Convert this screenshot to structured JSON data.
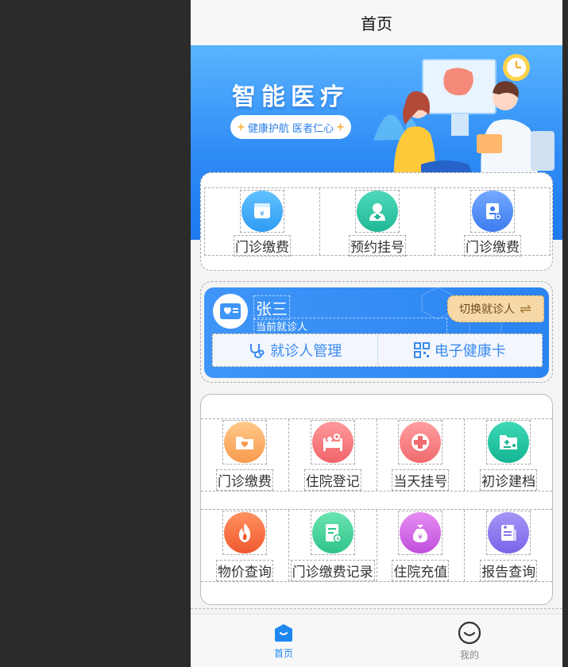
{
  "header": {
    "title": "首页"
  },
  "banner": {
    "title": "智能医疗",
    "slogan": "健康护航 医者仁心"
  },
  "quick_actions": [
    {
      "label": "门诊缴费",
      "icon": "wallet-icon",
      "color": "#3da7f8"
    },
    {
      "label": "预约挂号",
      "icon": "nurse-icon",
      "color": "#2fc6a8"
    },
    {
      "label": "门诊缴费",
      "icon": "id-card-icon",
      "color": "#4f8df5"
    }
  ],
  "patient_card": {
    "name": "张三",
    "subtitle": "当前就诊人",
    "switch_label": "切换就诊人",
    "manage_label": "就诊人管理",
    "health_card_label": "电子健康卡"
  },
  "services": [
    {
      "label": "门诊缴费",
      "icon": "folder-heart-icon",
      "color": "#fbb06c"
    },
    {
      "label": "住院登记",
      "icon": "hospital-bed-icon",
      "color": "#f4787d"
    },
    {
      "label": "当天挂号",
      "icon": "medical-cross-icon",
      "color": "#f48385"
    },
    {
      "label": "初诊建档",
      "icon": "patient-file-icon",
      "color": "#2fc6a8"
    },
    {
      "label": "物价查询",
      "icon": "flame-icon",
      "color": "#f6784a"
    },
    {
      "label": "门诊缴费记录",
      "icon": "document-record-icon",
      "color": "#4cd59a"
    },
    {
      "label": "住院充值",
      "icon": "money-bag-icon",
      "color": "#d76ae6"
    },
    {
      "label": "报告查询",
      "icon": "report-icon",
      "color": "#8d7bee"
    }
  ],
  "tabbar": [
    {
      "label": "首页",
      "icon": "home-icon",
      "active": true
    },
    {
      "label": "我的",
      "icon": "smile-icon",
      "active": false
    }
  ],
  "colors": {
    "primary": "#2a84f2",
    "switch_bg": "#f7d9a8",
    "active_tab": "#1e88f0"
  }
}
